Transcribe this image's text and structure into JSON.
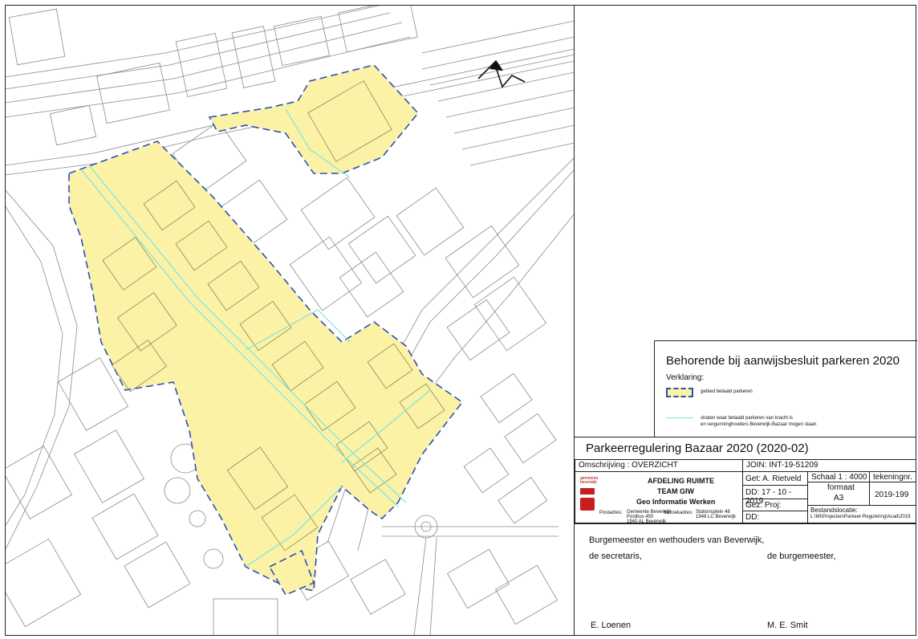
{
  "legend": {
    "title": "Behorende bij aanwijsbesluit parkeren 2020",
    "subtitle": "Verklaring:",
    "item_paid_label": "gebied betaald parkeren",
    "item_streets_line1": "straten waar betaald parkeren van kracht is",
    "item_streets_line2": "en vergunninghouders Beverwijk-Bazaar mogen staan"
  },
  "titleblock": {
    "project_title": "Parkeerregulering Bazaar 2020 (2020-02)",
    "omschrijving": "Omschrijving : OVERZICHT",
    "join": "JOIN: INT-19-51209",
    "department1": "AFDELING RUIMTE",
    "department2": "TEAM GIW",
    "department3": "Geo Informatie Werken",
    "logo_text1": "gemeente",
    "logo_text2": "beverwijk",
    "address_postadres": "Postadres:",
    "address_line1": "Gemeente Beverwijk",
    "address_line2": "Postbus 450",
    "address_line3": "1940 AL Beverwijk",
    "address_bezoek": "Bezoekadres:",
    "address_line4": "Stationsplein 48",
    "address_line5": "1948 LC Beverwijk",
    "get": "Get: A. Rietveld",
    "dd1": "DD: 17 - 10 - 2019",
    "gez_proj": "Gez. Proj:",
    "dd2": "DD:",
    "schaal": "Schaal 1 : 4000",
    "formaat_label": "formaat",
    "formaat_value": "A3",
    "tekeningnr_label": "tekeningnr.",
    "tekeningnr_value": "2019-199",
    "bestandslocatie_label": "Bestandslocatie:",
    "bestandslocatie_value": "L:\\MI\\Projecten\\Parkeer-Regulering\\Acad\\2019"
  },
  "signatures": {
    "line1": "Burgemeester en wethouders van Beverwijk,",
    "secretaris_label": "de secretaris,",
    "burgemeester_label": "de burgemeester,",
    "secretaris_name": "E. Loenen",
    "burgemeester_name": "M. E. Smit"
  },
  "colors": {
    "zone_fill": "#fbf2a6",
    "zone_border": "#2a4fb5",
    "streets": "#7fe3e0",
    "base_lines": "#8a8a8a"
  },
  "icons": {
    "north_arrow": "north-arrow-icon",
    "municipality_logo": "beverwijk-logo-icon"
  }
}
